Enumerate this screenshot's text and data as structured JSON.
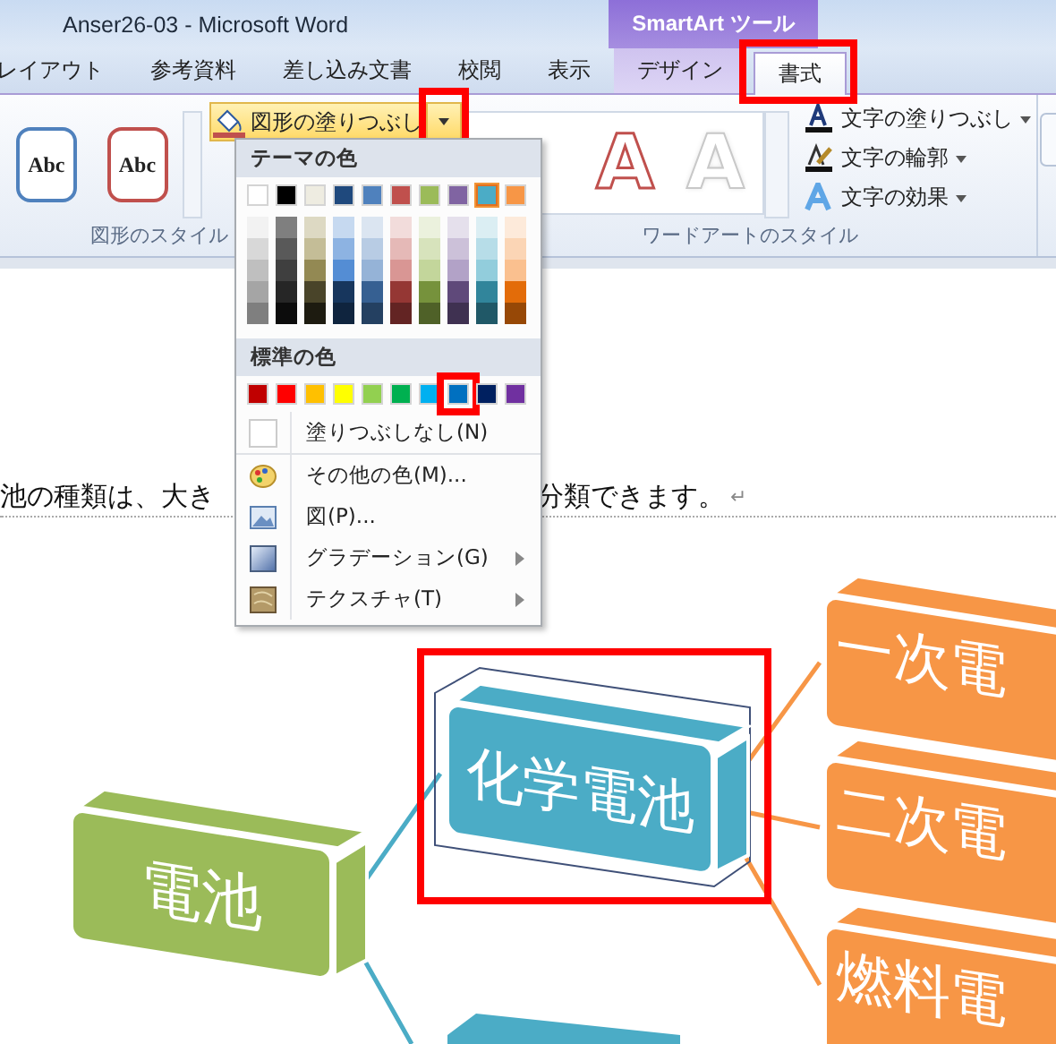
{
  "window": {
    "title": "Anser26-03  -  Microsoft Word"
  },
  "context_group": {
    "label": "SmartArt ツール"
  },
  "tabs": [
    {
      "label": "レイアウト",
      "selected": false,
      "context": false,
      "highlighted": false
    },
    {
      "label": "参考資料",
      "selected": false,
      "context": false,
      "highlighted": false
    },
    {
      "label": "差し込み文書",
      "selected": false,
      "context": false,
      "highlighted": false
    },
    {
      "label": "校閲",
      "selected": false,
      "context": false,
      "highlighted": false
    },
    {
      "label": "表示",
      "selected": false,
      "context": false,
      "highlighted": false
    },
    {
      "label": "デザイン",
      "selected": false,
      "context": true,
      "highlighted": false
    },
    {
      "label": "書式",
      "selected": true,
      "context": true,
      "highlighted": true
    }
  ],
  "ribbon": {
    "shape_styles": {
      "label": "図形のスタイル",
      "styles": [
        {
          "label": "Abc",
          "color": "#4f81bd"
        },
        {
          "label": "Abc",
          "color": "#c0504d"
        }
      ],
      "fill_button": {
        "label": "図形の塗りつぶし",
        "arrow_highlighted": true
      }
    },
    "wordart": {
      "label": "ワードアートのスタイル",
      "styles": [
        {
          "letter": "A",
          "kind": "outline"
        },
        {
          "letter": "A",
          "kind": "glow"
        }
      ],
      "commands": [
        {
          "label": "文字の塗りつぶし",
          "kind": "fill"
        },
        {
          "label": "文字の輪郭",
          "kind": "outline"
        },
        {
          "label": "文字の効果",
          "kind": "effects"
        }
      ]
    }
  },
  "fill_menu": {
    "theme_heading": "テーマの色",
    "theme_colors": [
      {
        "color": "#ffffff",
        "selected": false,
        "shades": [
          {
            "color": "#f2f2f2"
          },
          {
            "color": "#d8d8d8"
          },
          {
            "color": "#bfbfbf"
          },
          {
            "color": "#a5a5a5"
          },
          {
            "color": "#7f7f7f"
          }
        ]
      },
      {
        "color": "#000000",
        "selected": false,
        "shades": [
          {
            "color": "#7f7f7f"
          },
          {
            "color": "#595959"
          },
          {
            "color": "#3f3f3f"
          },
          {
            "color": "#262626"
          },
          {
            "color": "#0c0c0c"
          }
        ]
      },
      {
        "color": "#eeece1",
        "selected": false,
        "shades": [
          {
            "color": "#ddd9c3"
          },
          {
            "color": "#c4bd97"
          },
          {
            "color": "#938953"
          },
          {
            "color": "#494429"
          },
          {
            "color": "#1d1b10"
          }
        ]
      },
      {
        "color": "#1f497d",
        "selected": false,
        "shades": [
          {
            "color": "#c6d9f0"
          },
          {
            "color": "#8db3e2"
          },
          {
            "color": "#548dd4"
          },
          {
            "color": "#17365d"
          },
          {
            "color": "#0f243e"
          }
        ]
      },
      {
        "color": "#4f81bd",
        "selected": false,
        "shades": [
          {
            "color": "#dbe5f1"
          },
          {
            "color": "#b8cce4"
          },
          {
            "color": "#95b3d7"
          },
          {
            "color": "#366092"
          },
          {
            "color": "#244061"
          }
        ]
      },
      {
        "color": "#c0504d",
        "selected": false,
        "shades": [
          {
            "color": "#f2dcdb"
          },
          {
            "color": "#e5b9b7"
          },
          {
            "color": "#d99694"
          },
          {
            "color": "#953734"
          },
          {
            "color": "#632423"
          }
        ]
      },
      {
        "color": "#9bbb59",
        "selected": false,
        "shades": [
          {
            "color": "#ebf1dd"
          },
          {
            "color": "#d7e3bc"
          },
          {
            "color": "#c3d69b"
          },
          {
            "color": "#76923c"
          },
          {
            "color": "#4f6128"
          }
        ]
      },
      {
        "color": "#8064a2",
        "selected": false,
        "shades": [
          {
            "color": "#e5e0ec"
          },
          {
            "color": "#ccc1d9"
          },
          {
            "color": "#b2a2c7"
          },
          {
            "color": "#5f497a"
          },
          {
            "color": "#3f3151"
          }
        ]
      },
      {
        "color": "#4bacc6",
        "selected": true,
        "shades": [
          {
            "color": "#dbeef3"
          },
          {
            "color": "#b7dde8"
          },
          {
            "color": "#92cddc"
          },
          {
            "color": "#31859b"
          },
          {
            "color": "#205867"
          }
        ]
      },
      {
        "color": "#f79646",
        "selected": false,
        "shades": [
          {
            "color": "#fdeada"
          },
          {
            "color": "#fbd5b5"
          },
          {
            "color": "#fac08f"
          },
          {
            "color": "#e36c09"
          },
          {
            "color": "#974806"
          }
        ]
      }
    ],
    "standard_heading": "標準の色",
    "standard_colors": [
      {
        "color": "#c00000",
        "highlighted": false
      },
      {
        "color": "#ff0000",
        "highlighted": false
      },
      {
        "color": "#ffc000",
        "highlighted": false
      },
      {
        "color": "#ffff00",
        "highlighted": false
      },
      {
        "color": "#92d050",
        "highlighted": false
      },
      {
        "color": "#00b050",
        "highlighted": false
      },
      {
        "color": "#00b0f0",
        "highlighted": false
      },
      {
        "color": "#0070c0",
        "highlighted": true
      },
      {
        "color": "#002060",
        "highlighted": false
      },
      {
        "color": "#7030a0",
        "highlighted": false
      }
    ],
    "no_fill": "塗りつぶしなし(N)",
    "items": [
      {
        "label": "その他の色(M)...",
        "kind": "palette",
        "submenu": false
      },
      {
        "label": "図(P)...",
        "kind": "picture",
        "submenu": false
      },
      {
        "label": "グラデーション(G)",
        "kind": "gradient",
        "submenu": true
      },
      {
        "label": "テクスチャ(T)",
        "kind": "texture",
        "submenu": true
      }
    ]
  },
  "document": {
    "text_before": "池の種類は、大き",
    "text_after": "分類できます。",
    "paragraph_mark": "↵"
  },
  "diagram": {
    "root": {
      "label": "電池",
      "color": "#9bbb59"
    },
    "branches": [
      {
        "label": "化学電池",
        "color": "#4bacc6",
        "highlighted": true
      }
    ],
    "leaves": [
      {
        "label": "一次電",
        "color": "#f79646"
      },
      {
        "label": "二次電",
        "color": "#f79646"
      },
      {
        "label": "燃料電",
        "color": "#f79646"
      }
    ]
  }
}
